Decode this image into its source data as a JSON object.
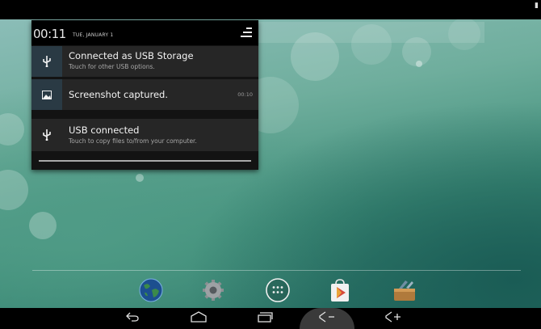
{
  "status_bar": {
    "indicator_icon": "battery-icon"
  },
  "shade": {
    "clock": "00:11",
    "date": "TUE, JANUARY 1",
    "notifications": [
      {
        "icon": "usb-icon",
        "title": "Connected as USB Storage",
        "subtitle": "Touch for other USB options.",
        "time": ""
      },
      {
        "icon": "image-icon",
        "title": "Screenshot captured.",
        "subtitle": "",
        "time": "00:10"
      },
      {
        "icon": "usb-icon",
        "title": "USB connected",
        "subtitle": "Touch to copy files to/from your computer.",
        "time": ""
      }
    ]
  },
  "dock": {
    "apps": [
      {
        "name": "browser",
        "icon": "globe-icon"
      },
      {
        "name": "settings",
        "icon": "gear-icon"
      },
      {
        "name": "all-apps",
        "icon": "app-drawer-icon"
      },
      {
        "name": "play-store",
        "icon": "play-store-icon"
      },
      {
        "name": "file-manager",
        "icon": "toolbox-icon"
      }
    ]
  },
  "nav_bar": {
    "back": "⟲",
    "home": "⌂",
    "recents": "▭",
    "volume_down": "◁−",
    "volume_up": "◁+"
  },
  "colors": {
    "shade_bg": "#131313",
    "notif_bg": "#262626",
    "accent_bg": "#2a3a44"
  }
}
